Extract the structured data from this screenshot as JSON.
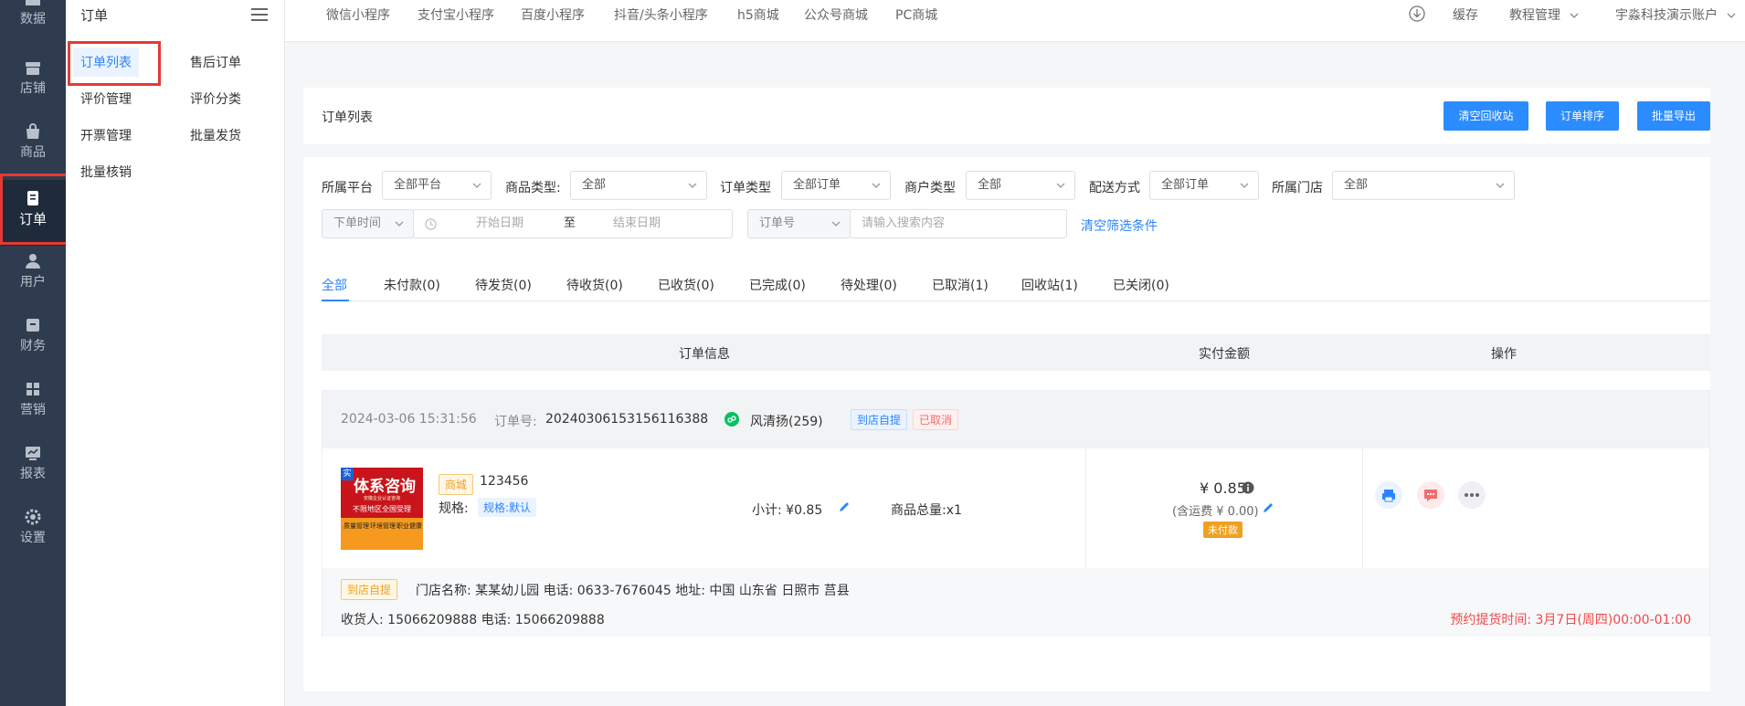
{
  "sidebar": {
    "items": [
      {
        "label": "数据",
        "icon": "home-icon"
      },
      {
        "label": "店铺",
        "icon": "store-icon"
      },
      {
        "label": "商品",
        "icon": "bag-icon"
      },
      {
        "label": "订单",
        "icon": "order-icon"
      },
      {
        "label": "用户",
        "icon": "user-icon"
      },
      {
        "label": "财务",
        "icon": "wallet-icon"
      },
      {
        "label": "营销",
        "icon": "grid-icon"
      },
      {
        "label": "报表",
        "icon": "chart-icon"
      },
      {
        "label": "设置",
        "icon": "gear-icon"
      }
    ]
  },
  "subnav": {
    "title": "订单",
    "items": [
      "订单列表",
      "售后订单",
      "评价管理",
      "评价分类",
      "开票管理",
      "批量发货",
      "批量核销"
    ]
  },
  "topbar": {
    "tabs": [
      "微信小程序",
      "支付宝小程序",
      "百度小程序",
      "抖音/头条小程序",
      "h5商城",
      "公众号商城",
      "PC商城"
    ],
    "cache": "缓存",
    "tutorial": "教程管理",
    "account": "宇淼科技演示账户"
  },
  "page": {
    "title": "订单列表",
    "buttons": [
      "清空回收站",
      "订单排序",
      "批量导出"
    ]
  },
  "filters": {
    "platform_label": "所属平台",
    "platform_value": "全部平台",
    "goods_type_label": "商品类型:",
    "goods_type_value": "全部",
    "order_type_label": "订单类型",
    "order_type_value": "全部订单",
    "merchant_type_label": "商户类型",
    "merchant_type_value": "全部",
    "delivery_label": "配送方式",
    "delivery_value": "全部订单",
    "store_label": "所属门店",
    "store_value": "全部",
    "time_select": "下单时间",
    "start_placeholder": "开始日期",
    "to": "至",
    "end_placeholder": "结束日期",
    "order_no_select": "订单号",
    "search_placeholder": "请输入搜索内容",
    "clear": "清空筛选条件"
  },
  "order_tabs": [
    "全部",
    "未付款(0)",
    "待发货(0)",
    "待收货(0)",
    "已收货(0)",
    "已完成(0)",
    "待处理(0)",
    "已取消(1)",
    "回收站(1)",
    "已关闭(0)"
  ],
  "table": {
    "headers": [
      "订单信息",
      "实付金额",
      "操作"
    ]
  },
  "order": {
    "time": "2024-03-06 15:31:56",
    "order_no_label": "订单号:",
    "order_no": "20240306153156116388",
    "user": "风清扬(259)",
    "tag_pickup": "到店自提",
    "tag_cancelled": "已取消",
    "thumb": {
      "corner": "实",
      "headline": "体系咨询",
      "line1": "安徽企业认证咨询",
      "line2": "不限地区全国受理",
      "b1": "质量管理",
      "b2": "环境管理",
      "b3": "职业健康"
    },
    "shop_tag": "商城",
    "goods_name": "123456",
    "spec_label": "规格:",
    "spec_value": "规格:默认",
    "subtotal": "小计: ¥0.85",
    "quantity": "商品总量:x1",
    "paid": "¥ 0.85",
    "shipping": "(含运费 ¥ 0.00)",
    "pay_status": "未付款",
    "foot_tag": "到店自提",
    "store_info": "门店名称: 某某幼儿园 电话: 0633-7676045 地址: 中国 山东省 日照市 莒县",
    "receiver": "收货人: 15066209888 电话: 15066209888",
    "pickup_time": "预约提货时间: 3月7日(周四)00:00-01:00"
  },
  "colors": {
    "accent": "#2b84ff",
    "sidebar": "#2f3b4f",
    "danger": "#e53935",
    "warning": "#f0a020"
  }
}
